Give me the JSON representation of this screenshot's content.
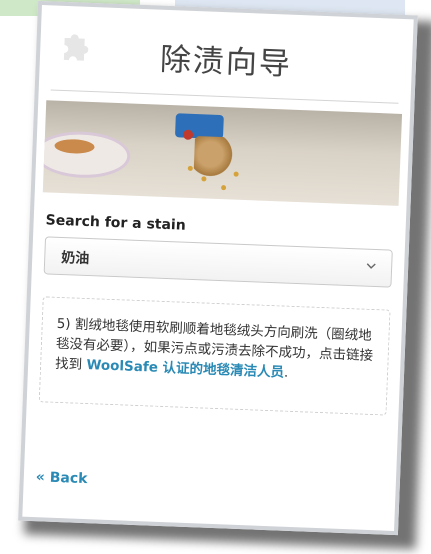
{
  "header": {
    "title": "除渍向导"
  },
  "search": {
    "label": "Search for a stain",
    "selected": "奶油"
  },
  "info": {
    "text_before": "5) 割绒地毯使用软刷顺着地毯绒头方向刷洗（圈绒地毯没有必要），如果污点或污渍去除不成功，点击链接找到",
    "link_text": "WoolSafe 认证的地毯清洁人员",
    "text_after": "."
  },
  "nav": {
    "back_label": "« Back"
  },
  "colors": {
    "link": "#2a8ab5",
    "title": "#444444"
  },
  "icons": {
    "header": "puzzle-icon",
    "select": "chevron-down-icon"
  }
}
